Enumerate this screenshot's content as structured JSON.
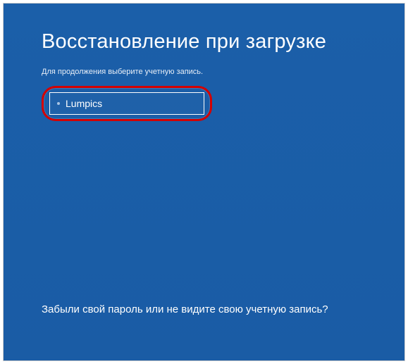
{
  "screen": {
    "title": "Восстановление при загрузке",
    "subtitle": "Для продолжения выберите учетную запись."
  },
  "accounts": [
    {
      "name": "Lumpics"
    }
  ],
  "footer": {
    "forgot_link": "Забыли свой пароль или не видите свою учетную запись?"
  }
}
